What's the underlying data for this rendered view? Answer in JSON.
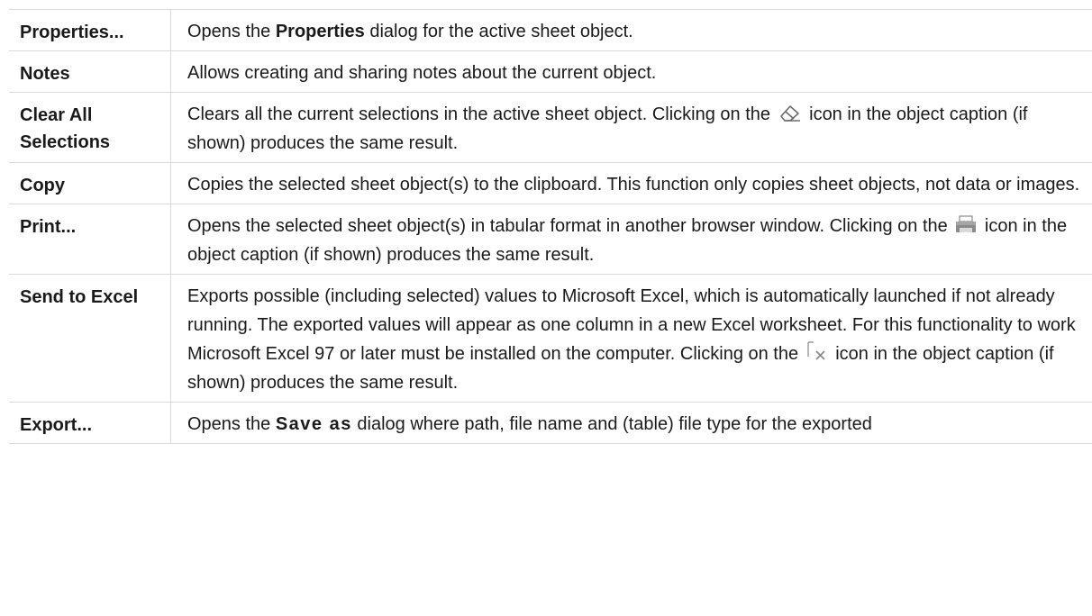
{
  "rows": [
    {
      "command": "Properties...",
      "desc_pre": "Opens the ",
      "desc_bold": "Properties",
      "desc_post": " dialog for the active sheet object."
    },
    {
      "command": "Notes",
      "desc": "Allows creating and sharing notes about the current object."
    },
    {
      "command": "Clear All Selections",
      "desc_pre": "Clears all the current selections in the active sheet object. Clicking on the ",
      "icon": "eraser-icon",
      "desc_post": " icon in the object caption (if shown) produces the same result."
    },
    {
      "command": "Copy",
      "desc": "Copies the selected sheet object(s) to the clipboard. This function only copies sheet objects, not data or images."
    },
    {
      "command": "Print...",
      "desc_pre": "Opens the selected sheet object(s) in tabular format in another browser window. Clicking on the ",
      "icon": "printer-icon",
      "desc_post": " icon in the object caption (if shown) produces the same result."
    },
    {
      "command": "Send to Excel",
      "desc_pre": "Exports possible (including selected) values to Microsoft Excel, which is automatically launched if not already running. The exported values will appear as one column in a new Excel worksheet. For this functionality to work Microsoft Excel 97 or later must be installed on the computer. Clicking on the ",
      "icon": "excel-export-icon",
      "desc_post": " icon in the object caption (if shown) produces the same result."
    },
    {
      "command": "Export...",
      "desc_pre": "Opens the ",
      "desc_bold": "Save as",
      "desc_post": " dialog where path, file name and (table) file type for the exported"
    }
  ]
}
